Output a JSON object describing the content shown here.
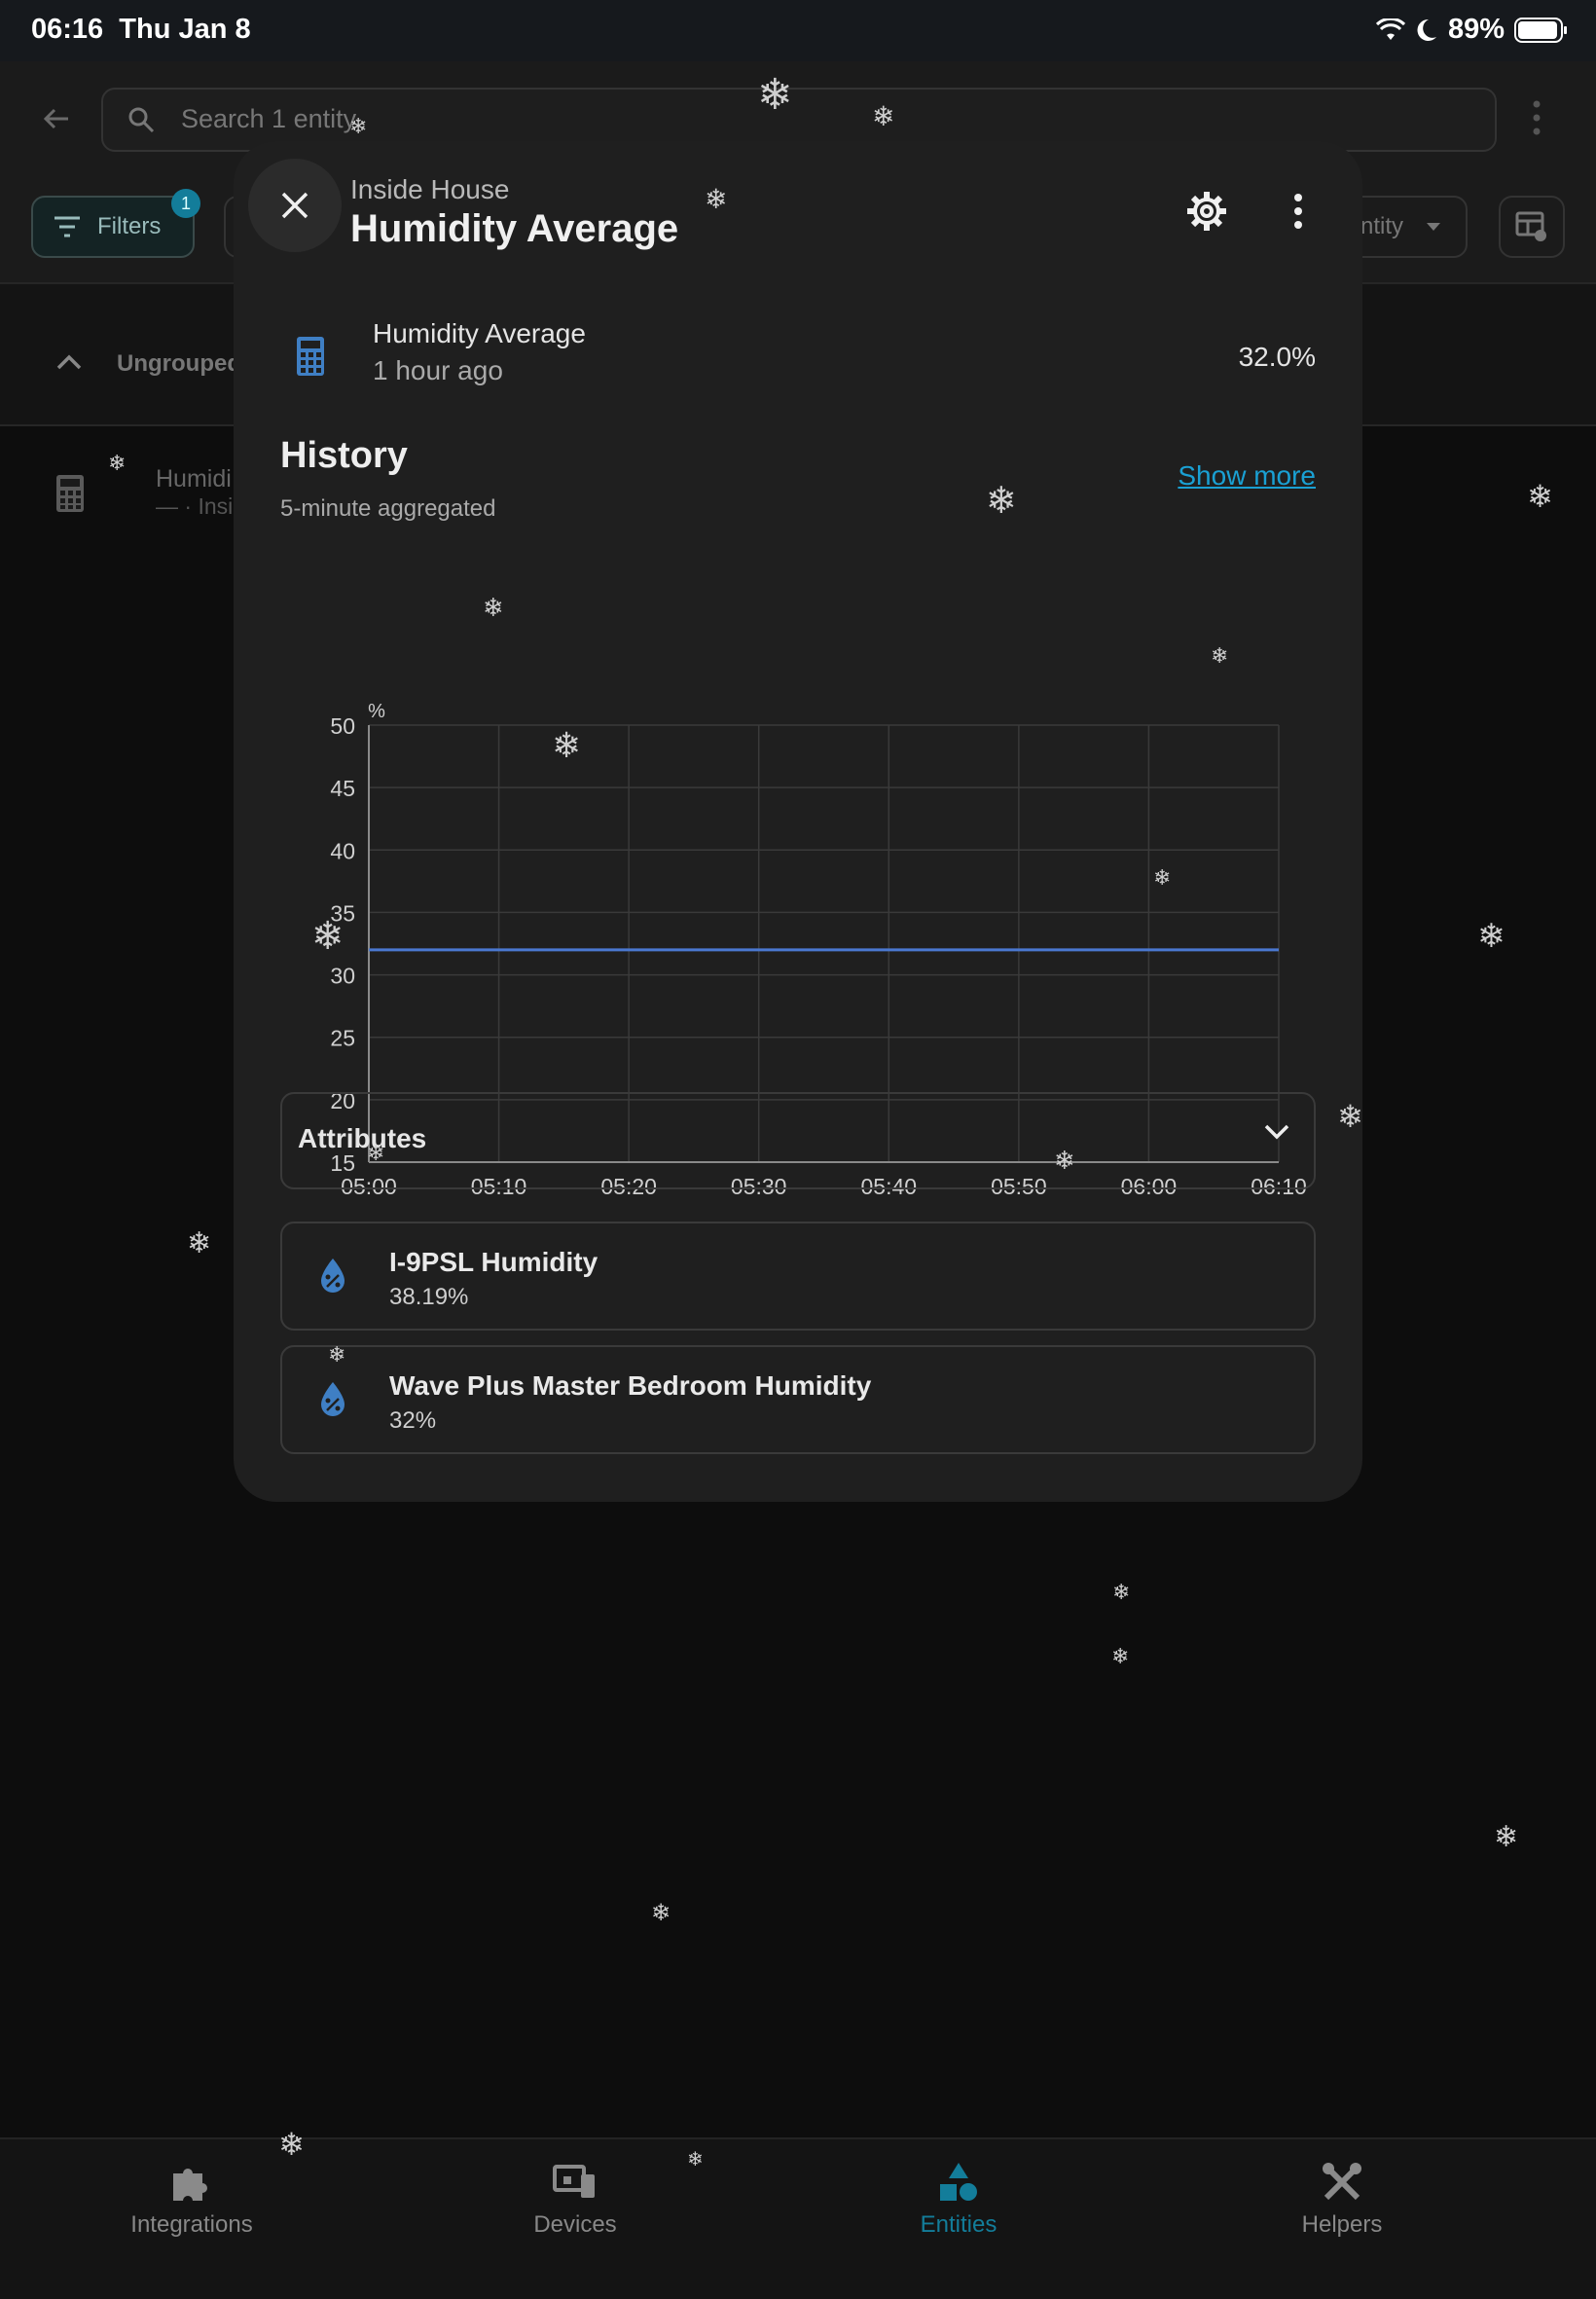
{
  "status_bar": {
    "time": "06:16",
    "date": "Thu Jan 8",
    "battery": "89%"
  },
  "background": {
    "search_placeholder": "Search 1 entity",
    "filters_label": "Filters",
    "filters_badge": "1",
    "group_by_label": "ntity",
    "group_header": "Ungrouped",
    "row_name": "Humidi",
    "row_sub": "— · Insi"
  },
  "dialog": {
    "area": "Inside House",
    "title": "Humidity Average",
    "entity": {
      "name": "Humidity Average",
      "last_changed": "1 hour ago",
      "state": "32.0%"
    },
    "history": {
      "title": "History",
      "subtitle": "5-minute aggregated",
      "show_more": "Show more"
    },
    "attributes_label": "Attributes",
    "members": [
      {
        "name": "I-9PSL Humidity",
        "value": "38.19%"
      },
      {
        "name": "Wave Plus Master Bedroom Humidity",
        "value": "32%"
      }
    ]
  },
  "chart_data": {
    "type": "line",
    "ylabel": "%",
    "ylim": [
      15,
      50
    ],
    "yticks": [
      "50",
      "45",
      "40",
      "35",
      "30",
      "25",
      "20",
      "15"
    ],
    "xticks": [
      "05:00",
      "05:10",
      "05:20",
      "05:30",
      "05:40",
      "05:50",
      "06:00",
      "06:10"
    ],
    "grid": true,
    "series": [
      {
        "x": [
          "05:00",
          "06:10"
        ],
        "values": [
          32,
          32
        ],
        "color": "#4a78d0"
      }
    ]
  },
  "bottom_nav": [
    {
      "label": "Integrations",
      "icon": "puzzle-icon",
      "active": false
    },
    {
      "label": "Devices",
      "icon": "devices-icon",
      "active": false
    },
    {
      "label": "Entities",
      "icon": "shapes-icon",
      "active": true
    },
    {
      "label": "Helpers",
      "icon": "tools-icon",
      "active": false
    }
  ],
  "colors": {
    "accent": "#137d9a",
    "link": "#1aa0d3",
    "icon_blue": "#3f7fc4",
    "line": "#4a78d0"
  }
}
